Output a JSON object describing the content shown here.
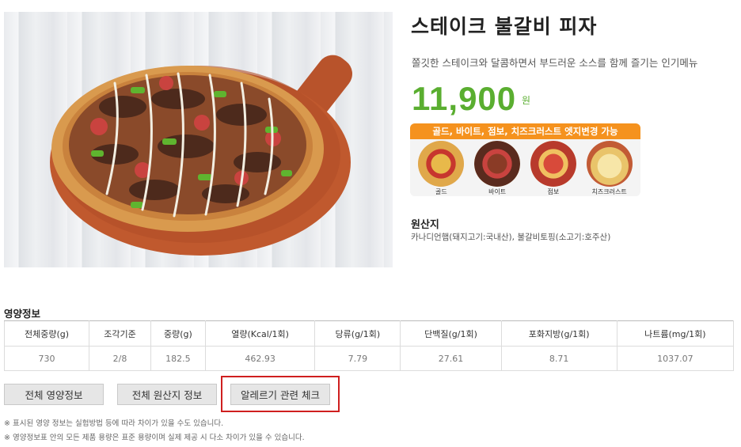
{
  "product": {
    "name": "스테이크 불갈비 피자",
    "description": "쫄깃한 스테이크와 달콤하면서 부드러운 소스를 함께 즐기는 인기메뉴",
    "price": "11,900",
    "price_unit": "원"
  },
  "edge_options": {
    "banner": "골드, 바이트, 점보, 치즈크러스트 엣지변경 가능",
    "items": [
      {
        "label": "골드",
        "icon": "gold-crust-pizza-icon"
      },
      {
        "label": "바이트",
        "icon": "bite-crust-pizza-icon"
      },
      {
        "label": "점보",
        "icon": "jumbo-crust-pizza-icon"
      },
      {
        "label": "치즈크러스트",
        "icon": "cheese-crust-pizza-icon"
      }
    ]
  },
  "origin": {
    "title": "원산지",
    "text": "카나디언햄(돼지고기:국내산), 불갈비토핑(소고기:호주산)"
  },
  "nutrition": {
    "title": "영양정보",
    "headers": [
      "전체중량(g)",
      "조각기준",
      "중량(g)",
      "열량(Kcal/1회)",
      "당류(g/1회)",
      "단백질(g/1회)",
      "포화지방(g/1회)",
      "나트륨(mg/1회)"
    ],
    "values": [
      "730",
      "2/8",
      "182.5",
      "462.93",
      "7.79",
      "27.61",
      "8.71",
      "1037.07"
    ]
  },
  "buttons": {
    "full_nutrition": "전체 영양정보",
    "full_origin": "전체 원산지 정보",
    "allergy_check": "알레르기 관련 체크"
  },
  "notes": [
    "※ 표시된 영양 정보는 실험방법 등에 따라 차이가 있을 수도 있습니다.",
    "※ 영양정보표 안의 모든 제품 용량은 표준 용량이며 실제 제공 시 다소 차이가 있을 수 있습니다."
  ],
  "colors": {
    "price": "#5aae30",
    "banner": "#f5921e",
    "highlight": "#cf1f1f"
  }
}
